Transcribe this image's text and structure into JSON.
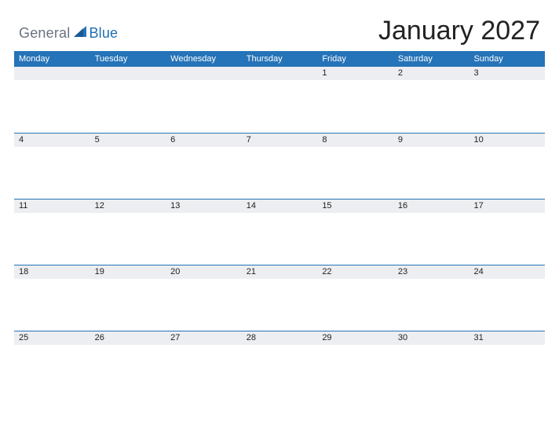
{
  "brand": {
    "word1": "General",
    "word2": "Blue"
  },
  "title": "January 2027",
  "colors": {
    "accent": "#2573b8",
    "headerRow": "#eceef1"
  },
  "dayHeaders": [
    "Monday",
    "Tuesday",
    "Wednesday",
    "Thursday",
    "Friday",
    "Saturday",
    "Sunday"
  ],
  "weeks": [
    [
      "",
      "",
      "",
      "",
      "1",
      "2",
      "3"
    ],
    [
      "4",
      "5",
      "6",
      "7",
      "8",
      "9",
      "10"
    ],
    [
      "11",
      "12",
      "13",
      "14",
      "15",
      "16",
      "17"
    ],
    [
      "18",
      "19",
      "20",
      "21",
      "22",
      "23",
      "24"
    ],
    [
      "25",
      "26",
      "27",
      "28",
      "29",
      "30",
      "31"
    ]
  ]
}
